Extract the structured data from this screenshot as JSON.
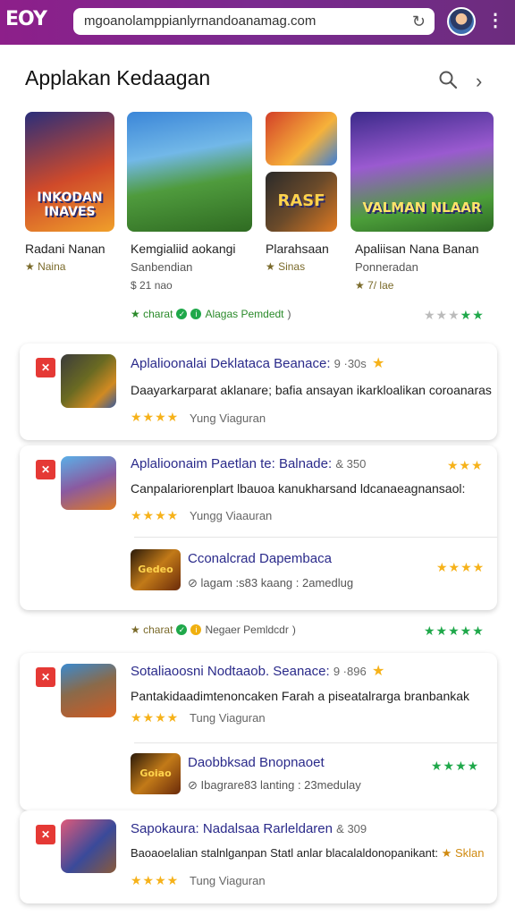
{
  "browser": {
    "logo": "EOY",
    "url": "mgoanolamppianlyrnandoanamag.com",
    "reload_icon": "reload-icon",
    "menu_icon": "kebab-menu-icon"
  },
  "section": {
    "title": "Applakan Kedaagan",
    "search_icon": "search-icon",
    "next_icon": "chevron-right-icon"
  },
  "featured": [
    {
      "art_text": "INKODAN\nINAVES",
      "name": "Radani Nanan",
      "sub": "",
      "rating": "★ Naina"
    },
    {
      "art_text": "",
      "name": "Kemgialiid aokangi",
      "sub": "Sanbendian",
      "rating": "$ 21 nao"
    },
    {
      "art_text": "RASF",
      "name": "Plarahsaan",
      "sub": "",
      "rating": "★ Sinas"
    },
    {
      "art_text": "VALMAN NLAAR",
      "name": "Apaliisan Nana Banan",
      "sub": "Ponneradan",
      "rating": "★ 7/ lae"
    }
  ],
  "meta_row": {
    "left_text": "★ charat",
    "right_text": "Alagas Pemdedt",
    "chevron": ")"
  },
  "apps": [
    {
      "title": "Aplalioonalai Deklataca Beanace:",
      "size": "9 ·30s",
      "desc": "Daayarkarparat aklanare; bafia ansayan ikarkloalikan coroanaras",
      "stars": "★★★★",
      "cat": "Yung Viaguran"
    },
    {
      "title": "Aplalioonaim Paetlan te: Balnade:",
      "size": "& 350",
      "desc": "Canpalariorenplart lbauoa kanukharsand ldcanaeagnansaol:",
      "stars": "★★★★",
      "cat": "Yungg Viaauran",
      "sub_title": "Cconalcrad Dapembaca",
      "sub_meta": "lagam :s83 kaang : 2amedlug",
      "sub_icon_text": "Gedeo"
    },
    {
      "title": "Sotaliaoosni Nodtaaob. Seanace:",
      "size": "9 ·896",
      "desc": "Pantakidaadimtenoncaken Farah a piseatalrarga branbankak",
      "stars": "★★★★",
      "cat": "Tung Viaguran",
      "sub_title": "Daobbksad Bnopnaoet",
      "sub_meta": "Ibagrare83 lanting : 23medulay",
      "sub_icon_text": "Goiao"
    },
    {
      "title": "Sapokaura: Nadalsaa Rarleldaren",
      "size": "& 309",
      "desc": "Baoaoelalian stalnlganpan Statl anlar blacalaldonopanikant:",
      "inline_rating": "★ Sklan",
      "stars": "★★★★",
      "cat": "Tung Viaguran"
    }
  ],
  "meta_row2": {
    "left_text": "★ charat",
    "right_text": "Negaer Pemldcdr",
    "chevron": ")"
  },
  "colors": {
    "accent": "#8d1f8a",
    "star": "#f6b21a",
    "green": "#1fa84a",
    "badge": "#e53935"
  }
}
